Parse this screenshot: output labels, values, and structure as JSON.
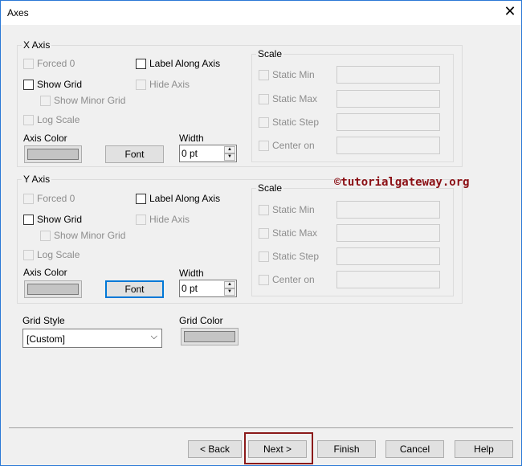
{
  "window": {
    "title": "Axes",
    "close_icon": "close-icon"
  },
  "x_axis": {
    "title": "X Axis",
    "forced0": "Forced 0",
    "label_along_axis": "Label Along Axis",
    "show_grid": "Show Grid",
    "hide_axis": "Hide Axis",
    "show_minor_grid": "Show Minor Grid",
    "log_scale": "Log Scale",
    "axis_color": "Axis Color",
    "font": "Font",
    "width_label": "Width",
    "width_value": "0 pt",
    "scale": {
      "title": "Scale",
      "static_min": "Static Min",
      "static_max": "Static Max",
      "static_step": "Static Step",
      "center_on": "Center on"
    }
  },
  "y_axis": {
    "title": "Y Axis",
    "forced0": "Forced 0",
    "label_along_axis": "Label Along Axis",
    "show_grid": "Show Grid",
    "hide_axis": "Hide Axis",
    "show_minor_grid": "Show Minor Grid",
    "log_scale": "Log Scale",
    "axis_color": "Axis Color",
    "font": "Font",
    "width_label": "Width",
    "width_value": "0 pt",
    "scale": {
      "title": "Scale",
      "static_min": "Static Min",
      "static_max": "Static Max",
      "static_step": "Static Step",
      "center_on": "Center on"
    }
  },
  "grid": {
    "style_label": "Grid Style",
    "style_value": "[Custom]",
    "color_label": "Grid Color"
  },
  "watermark": "©tutorialgateway.org",
  "buttons": {
    "back": "< Back",
    "next": "Next >",
    "finish": "Finish",
    "cancel": "Cancel",
    "help": "Help"
  },
  "colors": {
    "highlight": "#8b1a1a",
    "focus": "#0078d7"
  }
}
